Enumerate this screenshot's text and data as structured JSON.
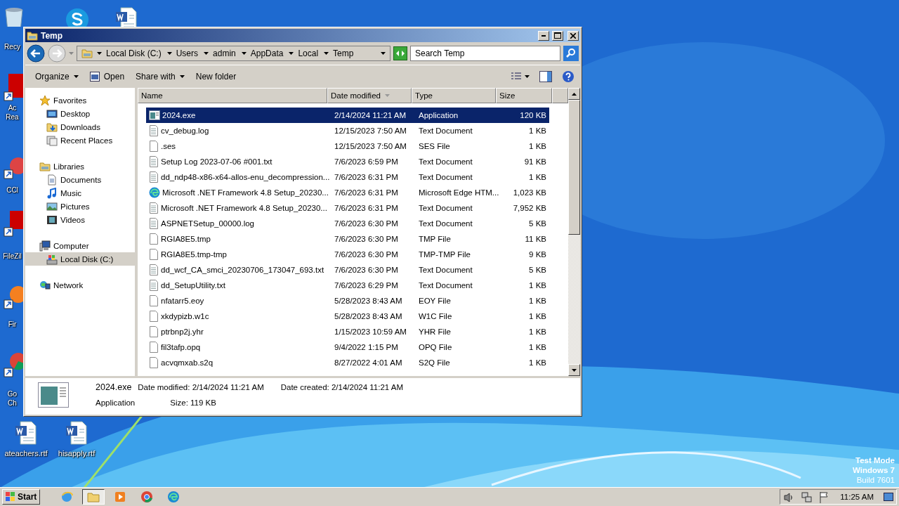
{
  "desktop_icons": [
    {
      "kind": "recycle",
      "lines": [
        "Recy"
      ]
    },
    {
      "kind": "skype"
    },
    {
      "kind": "word"
    },
    {
      "kind": "acrobat",
      "lines": [
        "Ac",
        "Rea"
      ]
    },
    {
      "kind": "ccleaner",
      "lines": [
        "CCl"
      ]
    },
    {
      "kind": "filezilla",
      "lines": [
        "FileZil"
      ]
    },
    {
      "kind": "firefox",
      "lines": [
        "Fir"
      ]
    },
    {
      "kind": "chrome",
      "lines": [
        "Go",
        "Ch"
      ]
    },
    {
      "kind": "word",
      "lines": [
        "ateachers.rtf"
      ]
    },
    {
      "kind": "word",
      "lines": [
        "hisapply.rtf"
      ]
    }
  ],
  "window": {
    "title": "Temp",
    "breadcrumb": [
      "Local Disk (C:)",
      "Users",
      "admin",
      "AppData",
      "Local",
      "Temp"
    ],
    "search": {
      "placeholder": "Search Temp"
    },
    "toolbar": [
      {
        "label": "Organize",
        "kind": "menu"
      },
      {
        "label": "Open",
        "kind": "open"
      },
      {
        "label": "Share with",
        "kind": "menu"
      },
      {
        "label": "New folder",
        "kind": "plain"
      }
    ],
    "nav": [
      {
        "label": "Favorites",
        "kind": "star",
        "items": [
          {
            "label": "Desktop",
            "kind": "desktop",
            "selected": false
          },
          {
            "label": "Downloads",
            "kind": "downloads",
            "selected": false
          },
          {
            "label": "Recent Places",
            "kind": "recent",
            "selected": false
          }
        ]
      },
      {
        "label": "Libraries",
        "kind": "libraries",
        "items": [
          {
            "label": "Documents",
            "kind": "documents",
            "selected": false
          },
          {
            "label": "Music",
            "kind": "music",
            "selected": false
          },
          {
            "label": "Pictures",
            "kind": "pictures",
            "selected": false
          },
          {
            "label": "Videos",
            "kind": "videos",
            "selected": false
          }
        ]
      },
      {
        "label": "Computer",
        "kind": "computer",
        "items": [
          {
            "label": "Local Disk (C:)",
            "kind": "disk",
            "selected": true
          }
        ]
      },
      {
        "label": "Network",
        "kind": "network"
      }
    ],
    "columns": [
      {
        "label": "Name",
        "sorted": false
      },
      {
        "label": "Date modified",
        "sorted": true
      },
      {
        "label": "Type",
        "sorted": false
      },
      {
        "label": "Size",
        "sorted": false
      }
    ],
    "rows": [
      {
        "name": "2024.exe",
        "date": "2/14/2024 11:21 AM",
        "type": "Application",
        "size": "120 KB",
        "kind": "exe",
        "selected": true
      },
      {
        "name": "cv_debug.log",
        "date": "12/15/2023 7:50 AM",
        "type": "Text Document",
        "size": "1 KB",
        "kind": "text",
        "selected": false
      },
      {
        "name": ".ses",
        "date": "12/15/2023 7:50 AM",
        "type": "SES File",
        "size": "1 KB",
        "kind": "blank",
        "selected": false
      },
      {
        "name": "Setup Log 2023-07-06 #001.txt",
        "date": "7/6/2023 6:59 PM",
        "type": "Text Document",
        "size": "91 KB",
        "kind": "text",
        "selected": false
      },
      {
        "name": "dd_ndp48-x86-x64-allos-enu_decompression...",
        "date": "7/6/2023 6:31 PM",
        "type": "Text Document",
        "size": "1 KB",
        "kind": "text",
        "selected": false
      },
      {
        "name": "Microsoft .NET Framework 4.8 Setup_20230...",
        "date": "7/6/2023 6:31 PM",
        "type": "Microsoft Edge HTM...",
        "size": "1,023 KB",
        "kind": "edge",
        "selected": false
      },
      {
        "name": "Microsoft .NET Framework 4.8 Setup_20230...",
        "date": "7/6/2023 6:31 PM",
        "type": "Text Document",
        "size": "7,952 KB",
        "kind": "text",
        "selected": false
      },
      {
        "name": "ASPNETSetup_00000.log",
        "date": "7/6/2023 6:30 PM",
        "type": "Text Document",
        "size": "5 KB",
        "kind": "text",
        "selected": false
      },
      {
        "name": "RGIA8E5.tmp",
        "date": "7/6/2023 6:30 PM",
        "type": "TMP File",
        "size": "11 KB",
        "kind": "blank",
        "selected": false
      },
      {
        "name": "RGIA8E5.tmp-tmp",
        "date": "7/6/2023 6:30 PM",
        "type": "TMP-TMP File",
        "size": "9 KB",
        "kind": "blank",
        "selected": false
      },
      {
        "name": "dd_wcf_CA_smci_20230706_173047_693.txt",
        "date": "7/6/2023 6:30 PM",
        "type": "Text Document",
        "size": "5 KB",
        "kind": "text",
        "selected": false
      },
      {
        "name": "dd_SetupUtility.txt",
        "date": "7/6/2023 6:29 PM",
        "type": "Text Document",
        "size": "1 KB",
        "kind": "text",
        "selected": false
      },
      {
        "name": "nfatarr5.eoy",
        "date": "5/28/2023 8:43 AM",
        "type": "EOY File",
        "size": "1 KB",
        "kind": "blank",
        "selected": false
      },
      {
        "name": "xkdypizb.w1c",
        "date": "5/28/2023 8:43 AM",
        "type": "W1C File",
        "size": "1 KB",
        "kind": "blank",
        "selected": false
      },
      {
        "name": "ptrbnp2j.yhr",
        "date": "1/15/2023 10:59 AM",
        "type": "YHR File",
        "size": "1 KB",
        "kind": "blank",
        "selected": false
      },
      {
        "name": "fil3tafp.opq",
        "date": "9/4/2022 1:15 PM",
        "type": "OPQ File",
        "size": "1 KB",
        "kind": "blank",
        "selected": false
      },
      {
        "name": "acvqmxab.s2q",
        "date": "8/27/2022 4:01 AM",
        "type": "S2Q File",
        "size": "1 KB",
        "kind": "blank",
        "selected": false
      }
    ],
    "details": {
      "name": "2024.exe",
      "type": "Application",
      "fields": [
        {
          "label": "Date modified:",
          "value": "2/14/2024 11:21 AM"
        },
        {
          "label": "Date created:",
          "value": "2/14/2024 11:21 AM"
        },
        {
          "label": "Size:",
          "value": "119 KB"
        }
      ]
    }
  },
  "os_info": [
    "Test Mode",
    "Windows 7",
    "Build 7601"
  ],
  "taskbar": {
    "start": "Start",
    "apps": [
      {
        "kind": "ie",
        "active": false
      },
      {
        "kind": "explorer",
        "active": true
      },
      {
        "kind": "media",
        "active": false
      },
      {
        "kind": "chrome",
        "active": false
      },
      {
        "kind": "edge",
        "active": false
      }
    ],
    "tray": [
      {
        "kind": "speaker"
      },
      {
        "kind": "network"
      },
      {
        "kind": "flag"
      }
    ],
    "clock": "11:25 AM"
  }
}
